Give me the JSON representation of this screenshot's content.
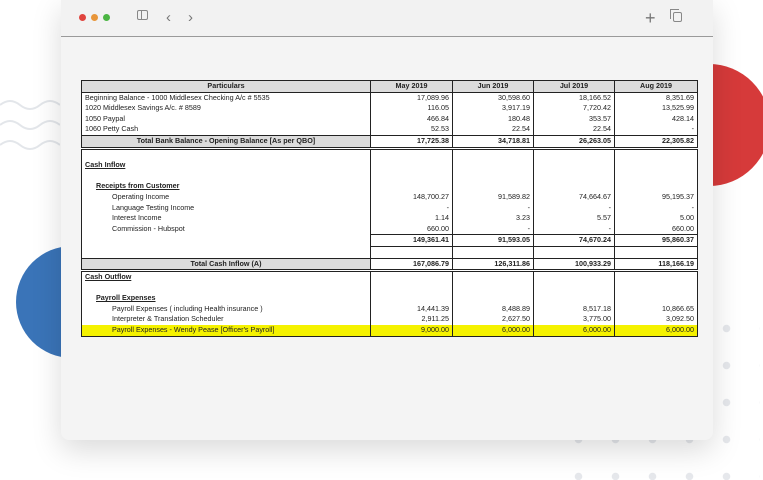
{
  "columns": [
    "Particulars",
    "May 2019",
    "Jun 2019",
    "Jul 2019",
    "Aug 2019"
  ],
  "rows": [
    {
      "type": "row",
      "label": "Beginning Balance - 1000 Middlesex Checking A/c # 5535",
      "values": [
        "17,089.96",
        "30,598.60",
        "18,166.52",
        "8,351.69"
      ]
    },
    {
      "type": "row",
      "label": "1020 Middlesex Savings A/c. # 8589",
      "values": [
        "116.05",
        "3,917.19",
        "7,720.42",
        "13,525.99"
      ]
    },
    {
      "type": "row",
      "label": "1050 Paypal",
      "values": [
        "466.84",
        "180.48",
        "353.57",
        "428.14"
      ]
    },
    {
      "type": "row",
      "label": "1060 Petty Cash",
      "values": [
        "52.53",
        "22.54",
        "22.54",
        "-"
      ]
    },
    {
      "type": "total",
      "label": "Total Bank Balance - Opening Balance [As per QBO]",
      "values": [
        "17,725.38",
        "34,718.81",
        "26,263.05",
        "22,305.82"
      ]
    },
    {
      "type": "blank"
    },
    {
      "type": "section",
      "label": "Cash Inflow"
    },
    {
      "type": "blank"
    },
    {
      "type": "subsection",
      "label": "Receipts from Customer"
    },
    {
      "type": "item",
      "label": "Operating Income",
      "values": [
        "148,700.27",
        "91,589.82",
        "74,664.67",
        "95,195.37"
      ]
    },
    {
      "type": "item",
      "label": "Language Testing Income",
      "values": [
        "-",
        "-",
        "-",
        "-"
      ]
    },
    {
      "type": "item",
      "label": "Interest Income",
      "values": [
        "1.14",
        "3.23",
        "5.57",
        "5.00"
      ]
    },
    {
      "type": "item",
      "label": "Commission - Hubspot",
      "values": [
        "660.00",
        "-",
        "-",
        "660.00"
      ]
    },
    {
      "type": "sub",
      "label": "",
      "values": [
        "149,361.41",
        "91,593.05",
        "74,670.24",
        "95,860.37"
      ]
    },
    {
      "type": "blank"
    },
    {
      "type": "total",
      "label": "Total Cash Inflow (A)",
      "values": [
        "167,086.79",
        "126,311.86",
        "100,933.29",
        "118,166.19"
      ]
    },
    {
      "type": "section",
      "label": "Cash Outflow"
    },
    {
      "type": "blank"
    },
    {
      "type": "subsection",
      "label": "Payroll Expenses"
    },
    {
      "type": "item",
      "label": "Payroll Expenses ( including Health insurance )",
      "values": [
        "14,441.39",
        "8,488.89",
        "8,517.18",
        "10,866.65"
      ]
    },
    {
      "type": "item",
      "label": "Interpreter & Translation Scheduler",
      "values": [
        "2,911.25",
        "2,627.50",
        "3,775.00",
        "3,092.50"
      ]
    },
    {
      "type": "highlight",
      "label": "Payroll Expenses - Wendy Pease [Officer's Payroll]",
      "values": [
        "9,000.00",
        "6,000.00",
        "6,000.00",
        "6,000.00"
      ]
    }
  ],
  "icons": [
    "sidebar-icon",
    "back-icon",
    "forward-icon",
    "new-tab-icon",
    "tabs-icon"
  ],
  "colors": {
    "highlight": "#f5f200",
    "red": "#d63a3a",
    "blue": "#3a74b8"
  }
}
